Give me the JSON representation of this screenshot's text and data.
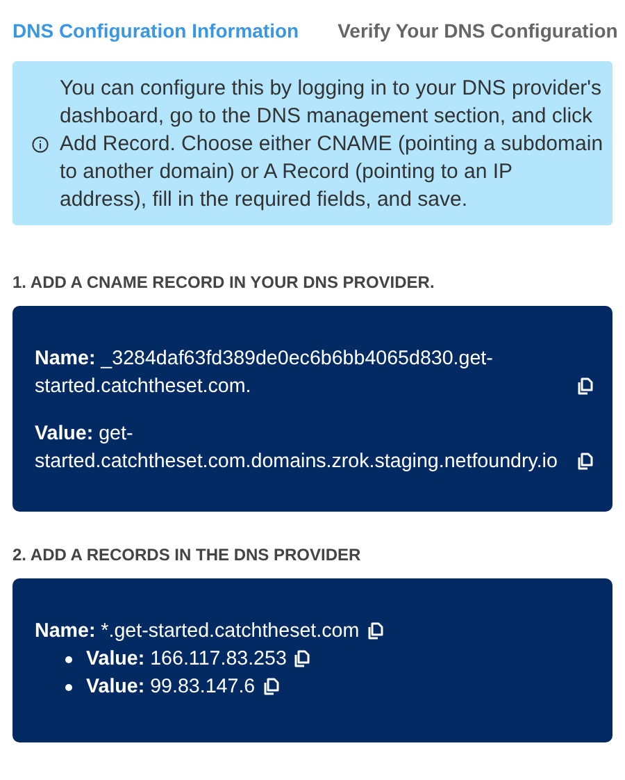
{
  "tabs": [
    {
      "label": "DNS Configuration Information",
      "selected": true
    },
    {
      "label": "Verify Your DNS Configuration",
      "selected": false
    }
  ],
  "info": {
    "text": "You can configure this by logging in to your DNS provider's dashboard, go to the DNS management section, and click Add Record. Choose either CNAME (pointing a subdomain to another domain) or A Record (pointing to an IP address), fill in the required fields, and save."
  },
  "sections": [
    {
      "heading": "1. ADD A CNAME RECORD IN YOUR DNS PROVIDER.",
      "fields": [
        {
          "kind": "plain",
          "text": "**Name:** _3284daf63fd389de0ec6b6bb4065d830.get-started.catchtheset.com."
        },
        {
          "kind": "plain",
          "text": "**Value:** get-started.catchtheset.com.domains.zrok.staging.netfoundry.io"
        }
      ]
    },
    {
      "heading": "2. ADD A RECORDS IN THE DNS PROVIDER",
      "fields": [
        {
          "kind": "plain",
          "text": "**Name:** *.get-started.catchtheset.com"
        },
        {
          "kind": "bullet",
          "text": "**Value:** 166.117.83.253"
        },
        {
          "kind": "bullet",
          "text": "**Value:** 99.83.147.6"
        }
      ]
    }
  ]
}
